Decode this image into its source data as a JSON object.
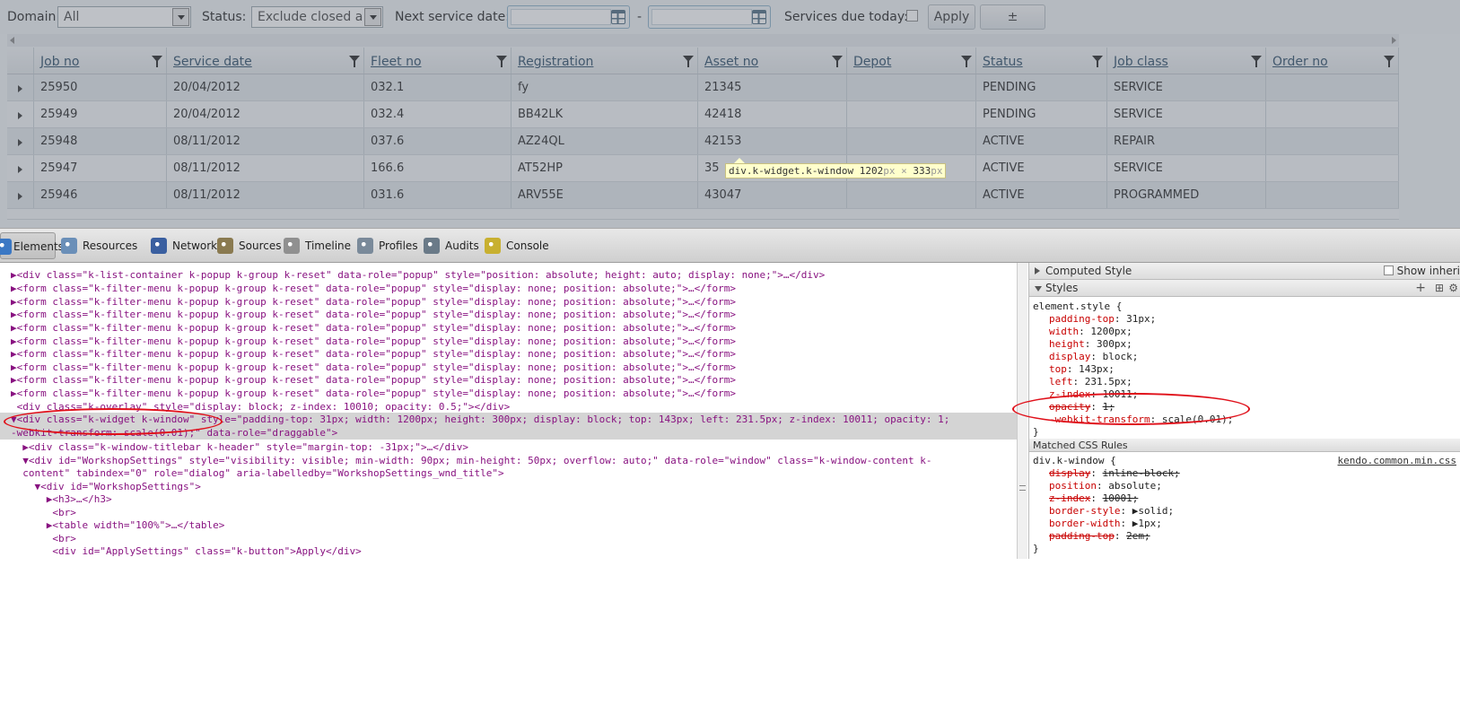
{
  "filters": {
    "domain_label": "Domain:",
    "domain_value": "All",
    "status_label": "Status:",
    "status_value": "Exclude closed an",
    "next_service_label": "Next service date:",
    "date_separator": "-",
    "services_due_label": "Services due today:",
    "apply_label": "Apply",
    "plus_label": "±"
  },
  "grid": {
    "columns": [
      "Job no",
      "Service date",
      "Fleet no",
      "Registration",
      "Asset no",
      "Depot",
      "Status",
      "Job class",
      "Order no"
    ],
    "rows": [
      [
        "25950",
        "20/04/2012",
        "032.1",
        "fy",
        "21345",
        "",
        "PENDING",
        "SERVICE",
        ""
      ],
      [
        "25949",
        "20/04/2012",
        "032.4",
        "BB42LK",
        "42418",
        "",
        "PENDING",
        "SERVICE",
        ""
      ],
      [
        "25948",
        "08/11/2012",
        "037.6",
        "AZ24QL",
        "42153",
        "",
        "ACTIVE",
        "REPAIR",
        ""
      ],
      [
        "25947",
        "08/11/2012",
        "166.6",
        "AT52HP",
        "35",
        "",
        "ACTIVE",
        "SERVICE",
        ""
      ],
      [
        "25946",
        "08/11/2012",
        "031.6",
        "ARV55E",
        "43047",
        "",
        "ACTIVE",
        "PROGRAMMED",
        ""
      ]
    ]
  },
  "tooltip": {
    "selector": "div.k-widget.k-window",
    "width": "1202",
    "height": "333",
    "unit": "px",
    "times": "×"
  },
  "devtools": {
    "tabs": [
      "Elements",
      "Resources",
      "Network",
      "Sources",
      "Timeline",
      "Profiles",
      "Audits",
      "Console"
    ],
    "selected_tab": "Elements",
    "dom_lines": [
      "▶<div class=\"k-list-container k-popup k-group k-reset\" data-role=\"popup\" style=\"position: absolute; height: auto; display: none;\">…</div>",
      "▶<form class=\"k-filter-menu k-popup k-group k-reset\" data-role=\"popup\" style=\"display: none; position: absolute;\">…</form>",
      "▶<form class=\"k-filter-menu k-popup k-group k-reset\" data-role=\"popup\" style=\"display: none; position: absolute;\">…</form>",
      "▶<form class=\"k-filter-menu k-popup k-group k-reset\" data-role=\"popup\" style=\"display: none; position: absolute;\">…</form>",
      "▶<form class=\"k-filter-menu k-popup k-group k-reset\" data-role=\"popup\" style=\"display: none; position: absolute;\">…</form>",
      "▶<form class=\"k-filter-menu k-popup k-group k-reset\" data-role=\"popup\" style=\"display: none; position: absolute;\">…</form>",
      "▶<form class=\"k-filter-menu k-popup k-group k-reset\" data-role=\"popup\" style=\"display: none; position: absolute;\">…</form>",
      "▶<form class=\"k-filter-menu k-popup k-group k-reset\" data-role=\"popup\" style=\"display: none; position: absolute;\">…</form>",
      "▶<form class=\"k-filter-menu k-popup k-group k-reset\" data-role=\"popup\" style=\"display: none; position: absolute;\">…</form>",
      "▶<form class=\"k-filter-menu k-popup k-group k-reset\" data-role=\"popup\" style=\"display: none; position: absolute;\">…</form>",
      " <div class=\"k-overlay\" style=\"display: block; z-index: 10010; opacity: 0.5;\"></div>",
      "▼<div class=\"k-widget k-window\" style=\"padding-top: 31px; width: 1200px; height: 300px; display: block; top: 143px; left: 231.5px; z-index: 10011; opacity: 1;",
      "-webkit-transform: scale(0.01);\" data-role=\"draggable\">",
      "  ▶<div class=\"k-window-titlebar k-header\" style=\"margin-top: -31px;\">…</div>",
      "  ▼<div id=\"WorkshopSettings\" style=\"visibility: visible; min-width: 90px; min-height: 50px; overflow: auto;\" data-role=\"window\" class=\"k-window-content k-",
      "  content\" tabindex=\"0\" role=\"dialog\" aria-labelledby=\"WorkshopSettings_wnd_title\">",
      "    ▼<div id=\"WorkshopSettings\">",
      "      ▶<h3>…</h3>",
      "       <br>",
      "      ▶<table width=\"100%\">…</table>",
      "       <br>",
      "       <div id=\"ApplySettings\" class=\"k-button\">Apply</div>"
    ],
    "computed_style_label": "Computed Style",
    "show_inherited_label": "Show inheri",
    "styles_label": "Styles",
    "element_style_selector": "element.style {",
    "element_style": [
      {
        "prop": "padding-top",
        "val": "31px;"
      },
      {
        "prop": "width",
        "val": "1200px;"
      },
      {
        "prop": "height",
        "val": "300px;"
      },
      {
        "prop": "display",
        "val": "block;"
      },
      {
        "prop": "top",
        "val": "143px;"
      },
      {
        "prop": "left",
        "val": "231.5px;"
      },
      {
        "prop": "z-index",
        "val": "10011;"
      },
      {
        "prop": "opacity",
        "val": "1;"
      },
      {
        "prop": "-webkit-transform",
        "val": "scale(0.01);"
      }
    ],
    "close_brace": "}",
    "matched_rules_label": "Matched CSS Rules",
    "rule_selector": "div.k-window {",
    "rule_source": "kendo.common.min.css",
    "rule_props": [
      {
        "prop": "display",
        "val": "inline-block;",
        "struck": true
      },
      {
        "prop": "position",
        "val": "absolute;",
        "struck": false
      },
      {
        "prop": "z-index",
        "val": "10001;",
        "struck": true
      },
      {
        "prop": "border-style",
        "val": "▶solid;",
        "struck": false
      },
      {
        "prop": "border-width",
        "val": "▶1px;",
        "struck": false
      },
      {
        "prop": "padding-top",
        "val": "2em;",
        "struck": true
      }
    ]
  }
}
